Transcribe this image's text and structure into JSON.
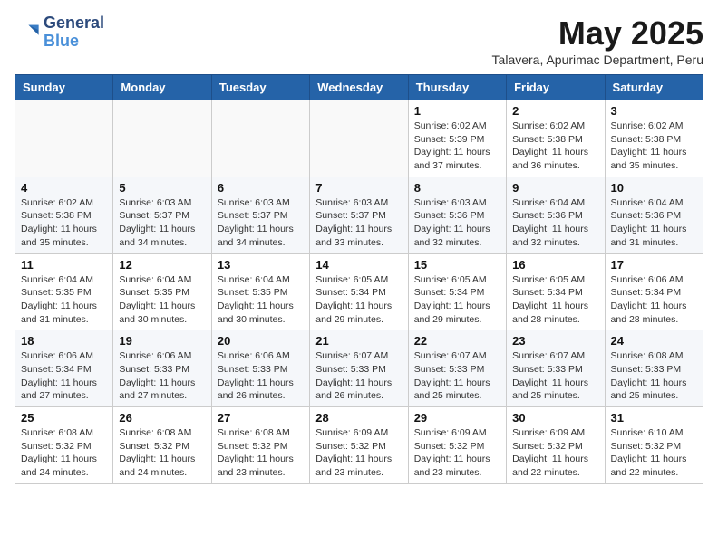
{
  "header": {
    "logo_general": "General",
    "logo_blue": "Blue",
    "month_title": "May 2025",
    "subtitle": "Talavera, Apurimac Department, Peru"
  },
  "weekdays": [
    "Sunday",
    "Monday",
    "Tuesday",
    "Wednesday",
    "Thursday",
    "Friday",
    "Saturday"
  ],
  "weeks": [
    [
      {
        "day": "",
        "info": ""
      },
      {
        "day": "",
        "info": ""
      },
      {
        "day": "",
        "info": ""
      },
      {
        "day": "",
        "info": ""
      },
      {
        "day": "1",
        "info": "Sunrise: 6:02 AM\nSunset: 5:39 PM\nDaylight: 11 hours\nand 37 minutes."
      },
      {
        "day": "2",
        "info": "Sunrise: 6:02 AM\nSunset: 5:38 PM\nDaylight: 11 hours\nand 36 minutes."
      },
      {
        "day": "3",
        "info": "Sunrise: 6:02 AM\nSunset: 5:38 PM\nDaylight: 11 hours\nand 35 minutes."
      }
    ],
    [
      {
        "day": "4",
        "info": "Sunrise: 6:02 AM\nSunset: 5:38 PM\nDaylight: 11 hours\nand 35 minutes."
      },
      {
        "day": "5",
        "info": "Sunrise: 6:03 AM\nSunset: 5:37 PM\nDaylight: 11 hours\nand 34 minutes."
      },
      {
        "day": "6",
        "info": "Sunrise: 6:03 AM\nSunset: 5:37 PM\nDaylight: 11 hours\nand 34 minutes."
      },
      {
        "day": "7",
        "info": "Sunrise: 6:03 AM\nSunset: 5:37 PM\nDaylight: 11 hours\nand 33 minutes."
      },
      {
        "day": "8",
        "info": "Sunrise: 6:03 AM\nSunset: 5:36 PM\nDaylight: 11 hours\nand 32 minutes."
      },
      {
        "day": "9",
        "info": "Sunrise: 6:04 AM\nSunset: 5:36 PM\nDaylight: 11 hours\nand 32 minutes."
      },
      {
        "day": "10",
        "info": "Sunrise: 6:04 AM\nSunset: 5:36 PM\nDaylight: 11 hours\nand 31 minutes."
      }
    ],
    [
      {
        "day": "11",
        "info": "Sunrise: 6:04 AM\nSunset: 5:35 PM\nDaylight: 11 hours\nand 31 minutes."
      },
      {
        "day": "12",
        "info": "Sunrise: 6:04 AM\nSunset: 5:35 PM\nDaylight: 11 hours\nand 30 minutes."
      },
      {
        "day": "13",
        "info": "Sunrise: 6:04 AM\nSunset: 5:35 PM\nDaylight: 11 hours\nand 30 minutes."
      },
      {
        "day": "14",
        "info": "Sunrise: 6:05 AM\nSunset: 5:34 PM\nDaylight: 11 hours\nand 29 minutes."
      },
      {
        "day": "15",
        "info": "Sunrise: 6:05 AM\nSunset: 5:34 PM\nDaylight: 11 hours\nand 29 minutes."
      },
      {
        "day": "16",
        "info": "Sunrise: 6:05 AM\nSunset: 5:34 PM\nDaylight: 11 hours\nand 28 minutes."
      },
      {
        "day": "17",
        "info": "Sunrise: 6:06 AM\nSunset: 5:34 PM\nDaylight: 11 hours\nand 28 minutes."
      }
    ],
    [
      {
        "day": "18",
        "info": "Sunrise: 6:06 AM\nSunset: 5:34 PM\nDaylight: 11 hours\nand 27 minutes."
      },
      {
        "day": "19",
        "info": "Sunrise: 6:06 AM\nSunset: 5:33 PM\nDaylight: 11 hours\nand 27 minutes."
      },
      {
        "day": "20",
        "info": "Sunrise: 6:06 AM\nSunset: 5:33 PM\nDaylight: 11 hours\nand 26 minutes."
      },
      {
        "day": "21",
        "info": "Sunrise: 6:07 AM\nSunset: 5:33 PM\nDaylight: 11 hours\nand 26 minutes."
      },
      {
        "day": "22",
        "info": "Sunrise: 6:07 AM\nSunset: 5:33 PM\nDaylight: 11 hours\nand 25 minutes."
      },
      {
        "day": "23",
        "info": "Sunrise: 6:07 AM\nSunset: 5:33 PM\nDaylight: 11 hours\nand 25 minutes."
      },
      {
        "day": "24",
        "info": "Sunrise: 6:08 AM\nSunset: 5:33 PM\nDaylight: 11 hours\nand 25 minutes."
      }
    ],
    [
      {
        "day": "25",
        "info": "Sunrise: 6:08 AM\nSunset: 5:32 PM\nDaylight: 11 hours\nand 24 minutes."
      },
      {
        "day": "26",
        "info": "Sunrise: 6:08 AM\nSunset: 5:32 PM\nDaylight: 11 hours\nand 24 minutes."
      },
      {
        "day": "27",
        "info": "Sunrise: 6:08 AM\nSunset: 5:32 PM\nDaylight: 11 hours\nand 23 minutes."
      },
      {
        "day": "28",
        "info": "Sunrise: 6:09 AM\nSunset: 5:32 PM\nDaylight: 11 hours\nand 23 minutes."
      },
      {
        "day": "29",
        "info": "Sunrise: 6:09 AM\nSunset: 5:32 PM\nDaylight: 11 hours\nand 23 minutes."
      },
      {
        "day": "30",
        "info": "Sunrise: 6:09 AM\nSunset: 5:32 PM\nDaylight: 11 hours\nand 22 minutes."
      },
      {
        "day": "31",
        "info": "Sunrise: 6:10 AM\nSunset: 5:32 PM\nDaylight: 11 hours\nand 22 minutes."
      }
    ]
  ]
}
